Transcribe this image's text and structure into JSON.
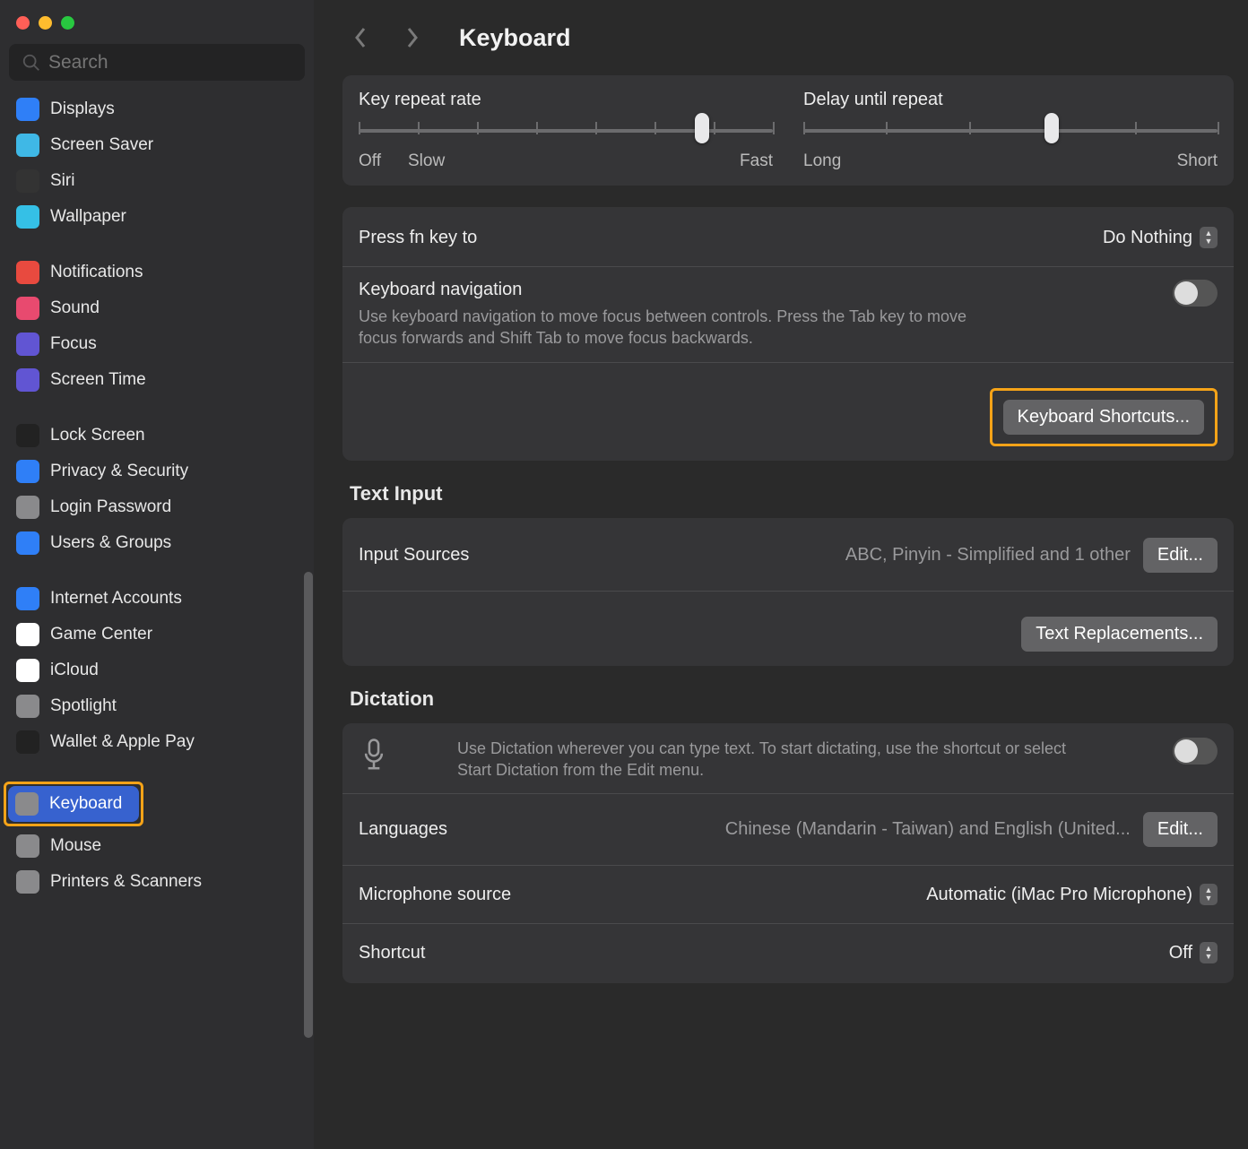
{
  "search": {
    "placeholder": "Search"
  },
  "page": {
    "title": "Keyboard"
  },
  "sidebar": {
    "items": [
      {
        "label": "Displays",
        "iconBg": "#2f7ff7"
      },
      {
        "label": "Screen Saver",
        "iconBg": "#3fb8e6"
      },
      {
        "label": "Siri",
        "iconBg": "#333"
      },
      {
        "label": "Wallpaper",
        "iconBg": "#35c0e6"
      },
      {
        "gap": true
      },
      {
        "label": "Notifications",
        "iconBg": "#e84a3f"
      },
      {
        "label": "Sound",
        "iconBg": "#e84a6f"
      },
      {
        "label": "Focus",
        "iconBg": "#6155d3"
      },
      {
        "label": "Screen Time",
        "iconBg": "#6155d3"
      },
      {
        "gap": true
      },
      {
        "label": "Lock Screen",
        "iconBg": "#222"
      },
      {
        "label": "Privacy & Security",
        "iconBg": "#2f7ff7"
      },
      {
        "label": "Login Password",
        "iconBg": "#8a8a8c"
      },
      {
        "label": "Users & Groups",
        "iconBg": "#2f7ff7"
      },
      {
        "gap": true
      },
      {
        "label": "Internet Accounts",
        "iconBg": "#2f7ff7"
      },
      {
        "label": "Game Center",
        "iconBg": "#fff"
      },
      {
        "label": "iCloud",
        "iconBg": "#fff"
      },
      {
        "label": "Spotlight",
        "iconBg": "#8a8a8c"
      },
      {
        "label": "Wallet & Apple Pay",
        "iconBg": "#222"
      },
      {
        "gap": true
      },
      {
        "label": "Keyboard",
        "iconBg": "#8a8a8c",
        "selected": true,
        "highlight": true
      },
      {
        "label": "Mouse",
        "iconBg": "#8a8a8c"
      },
      {
        "label": "Printers & Scanners",
        "iconBg": "#8a8a8c"
      }
    ]
  },
  "sliders": {
    "keyRepeat": {
      "label": "Key repeat rate",
      "left": "Off",
      "left2": "Slow",
      "right": "Fast",
      "pos": 0.83,
      "ticks": 8
    },
    "delay": {
      "label": "Delay until repeat",
      "left": "Long",
      "right": "Short",
      "pos": 0.6,
      "ticks": 6
    }
  },
  "fn": {
    "label": "Press fn key to",
    "value": "Do Nothing"
  },
  "kbnav": {
    "title": "Keyboard navigation",
    "desc": "Use keyboard navigation to move focus between controls. Press the Tab key to move focus forwards and Shift Tab to move focus backwards."
  },
  "kbShortcuts": "Keyboard Shortcuts...",
  "textInput": {
    "heading": "Text Input",
    "inputSourcesLabel": "Input Sources",
    "inputSourcesValue": "ABC, Pinyin - Simplified and 1 other",
    "edit": "Edit...",
    "textRepl": "Text Replacements..."
  },
  "dictation": {
    "heading": "Dictation",
    "desc": "Use Dictation wherever you can type text. To start dictating, use the shortcut or select Start Dictation from the Edit menu.",
    "languagesLabel": "Languages",
    "languagesValue": "Chinese (Mandarin - Taiwan) and English (United...",
    "edit": "Edit...",
    "micLabel": "Microphone source",
    "micValue": "Automatic (iMac Pro Microphone)",
    "shortcutLabel": "Shortcut",
    "shortcutValue": "Off"
  }
}
